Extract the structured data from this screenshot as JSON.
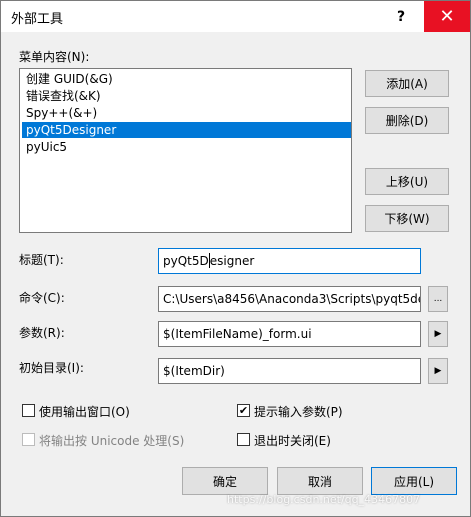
{
  "window": {
    "title": "外部工具",
    "help_label": "?",
    "close_label": "✕"
  },
  "menu_contents": {
    "label": "菜单内容(N):",
    "items": [
      {
        "label": "创建 GUID(&G)",
        "selected": false
      },
      {
        "label": "错误查找(&K)",
        "selected": false
      },
      {
        "label": "Spy++(&+)",
        "selected": false
      },
      {
        "label": "pyQt5Designer",
        "selected": true
      },
      {
        "label": "pyUic5",
        "selected": false
      }
    ]
  },
  "side_buttons": {
    "add": "添加(A)",
    "delete": "删除(D)",
    "move_up": "上移(U)",
    "move_down": "下移(W)"
  },
  "fields": {
    "title_label": "标题(T):",
    "title_value_before_caret": "pyQt5D",
    "title_value_after_caret": "esigner",
    "command_label": "命令(C):",
    "command_value": "C:\\Users\\a8456\\Anaconda3\\Scripts\\pyqt5de",
    "command_browse": "...",
    "args_label": "参数(R):",
    "args_value": "$(ItemFileName)_form.ui",
    "args_arrow": "▶",
    "initdir_label": "初始目录(I):",
    "initdir_value": "$(ItemDir)",
    "initdir_arrow": "▶"
  },
  "options": {
    "use_output_window": {
      "label": "使用输出窗口(O)",
      "checked": false,
      "enabled": true
    },
    "prompt_args": {
      "label": "提示输入参数(P)",
      "checked": true,
      "enabled": true
    },
    "treat_output_unicode": {
      "label": "将输出按 Unicode 处理(S)",
      "checked": false,
      "enabled": false
    },
    "close_on_exit": {
      "label": "退出时关闭(E)",
      "checked": false,
      "enabled": true
    },
    "check_mark": "✔"
  },
  "footer": {
    "ok": "确定",
    "cancel": "取消",
    "apply": "应用(L)"
  },
  "watermark": "https://blog.csdn.net/qq_43467807"
}
